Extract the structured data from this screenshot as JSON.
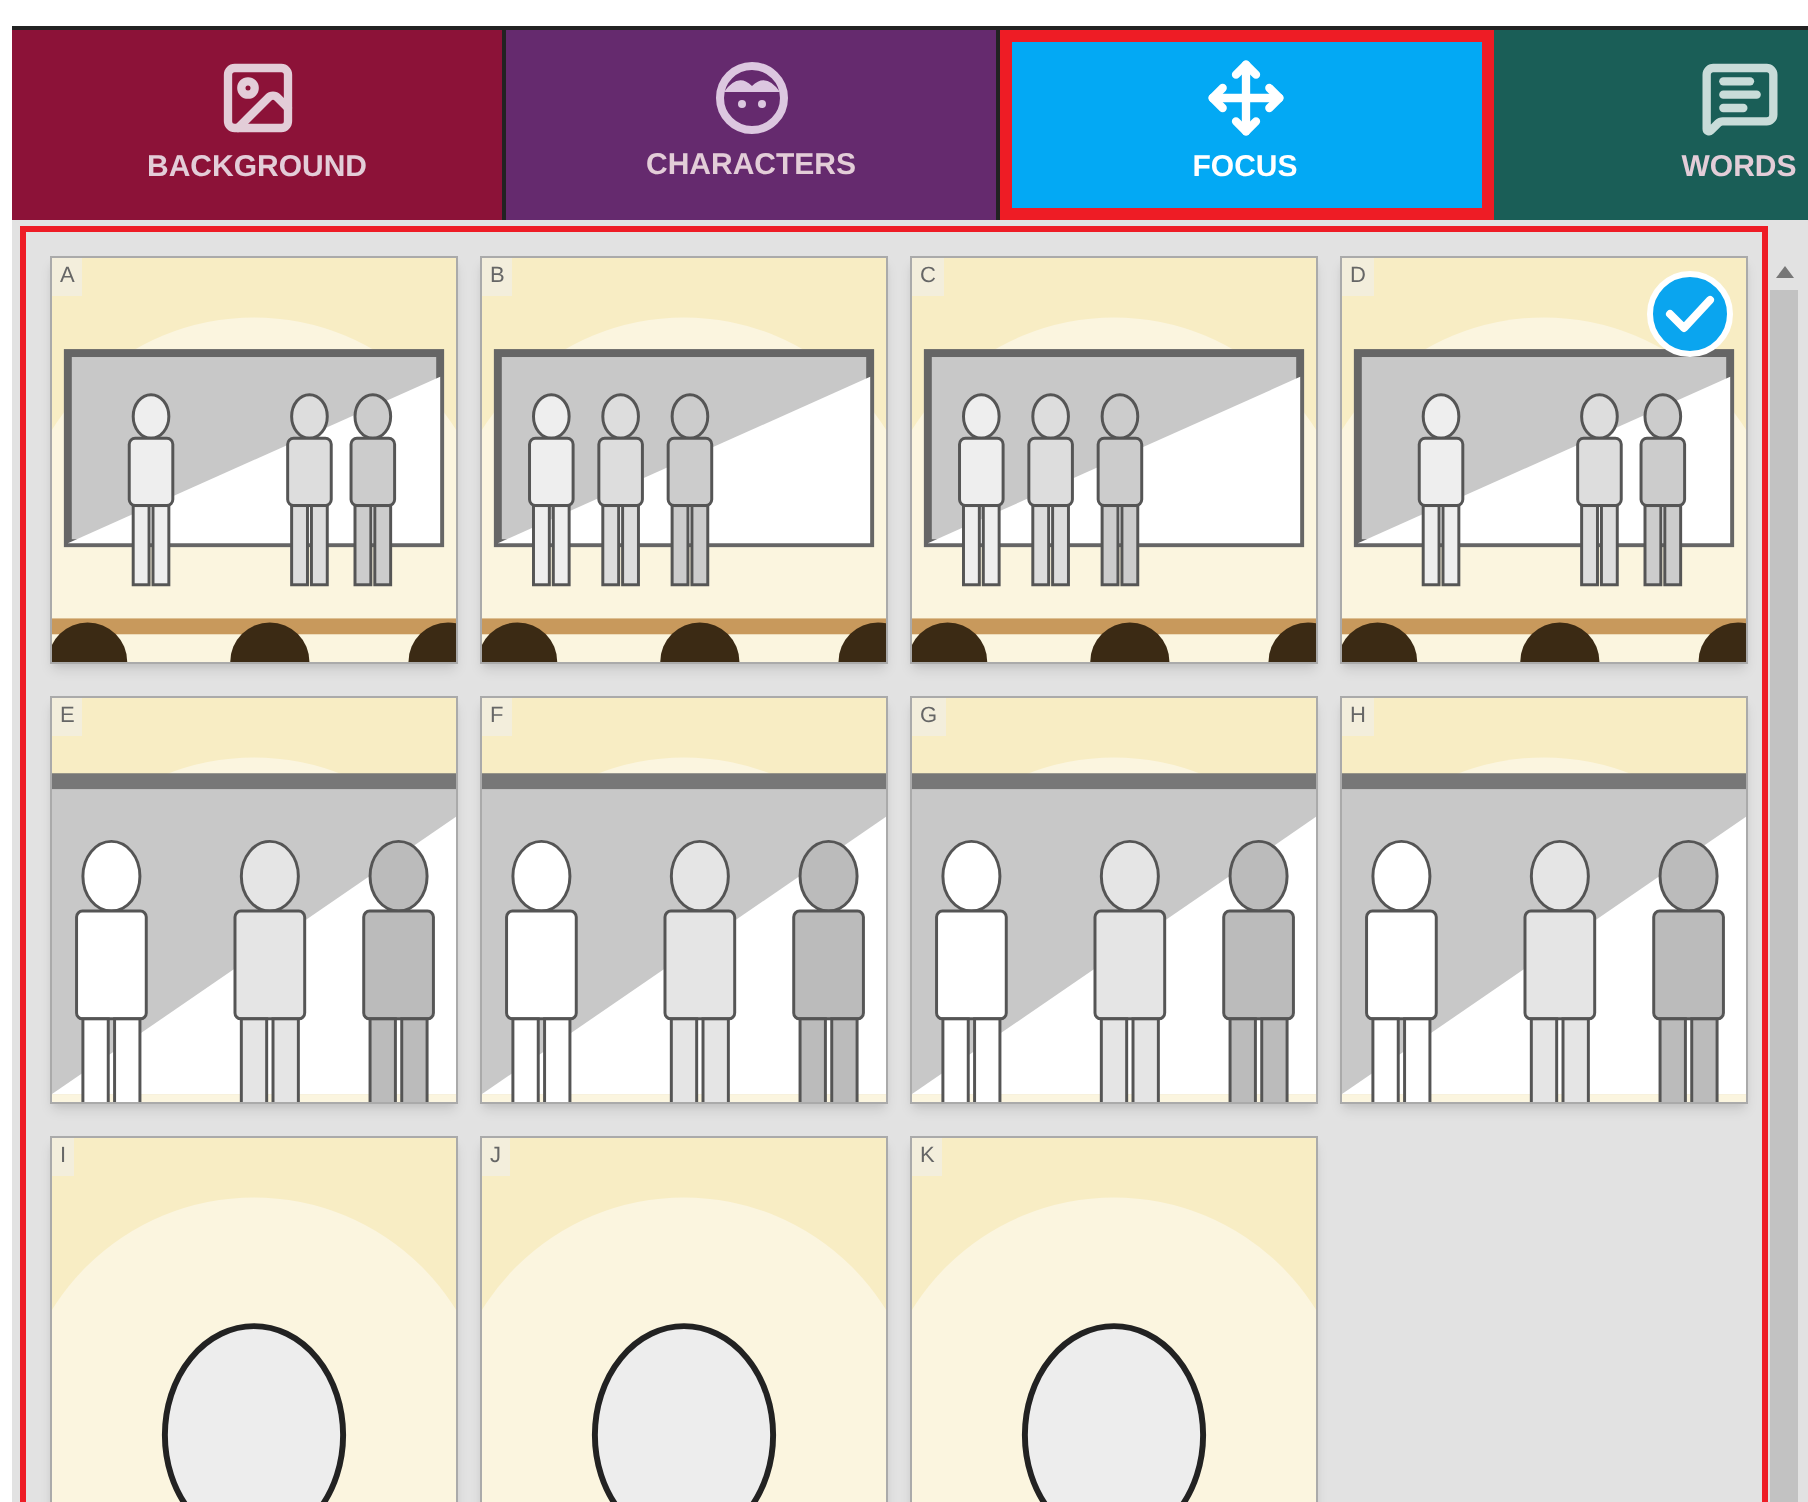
{
  "tabs": [
    {
      "label": "BACKGROUND",
      "kind": "image",
      "selected": false,
      "color": "#8c1238"
    },
    {
      "label": "CHARACTERS",
      "kind": "face",
      "selected": false,
      "color": "#652a6e"
    },
    {
      "label": "FOCUS",
      "kind": "move",
      "selected": true,
      "color": "#03a9f4"
    },
    {
      "label": "WORDS",
      "kind": "message",
      "selected": false,
      "color": "#1a5e57"
    }
  ],
  "thumbnails": [
    {
      "label": "A",
      "kind": "wide",
      "selected": false
    },
    {
      "label": "B",
      "kind": "walk",
      "selected": false
    },
    {
      "label": "C",
      "kind": "walk",
      "selected": false
    },
    {
      "label": "D",
      "kind": "wide",
      "selected": true
    },
    {
      "label": "E",
      "kind": "medium",
      "selected": false
    },
    {
      "label": "F",
      "kind": "medium",
      "selected": false
    },
    {
      "label": "G",
      "kind": "medium",
      "selected": false
    },
    {
      "label": "H",
      "kind": "medium",
      "selected": false
    },
    {
      "label": "I",
      "kind": "closeup",
      "selected": false
    },
    {
      "label": "J",
      "kind": "closeup",
      "selected": false
    },
    {
      "label": "K",
      "kind": "closeup",
      "selected": false
    }
  ]
}
